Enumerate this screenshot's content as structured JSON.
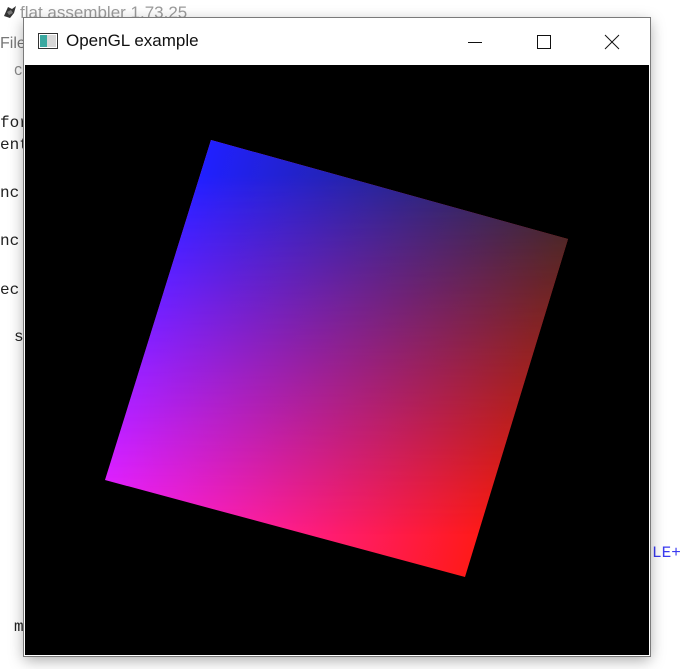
{
  "background_window": {
    "title": "flat assembler 1.73.25",
    "menu_file": "File",
    "tab_char": "C",
    "code_fragments": [
      {
        "text": "for",
        "color": "#222222"
      },
      {
        "text": "ent",
        "color": "#222222"
      },
      {
        "text": "nc",
        "color": "#222222"
      },
      {
        "text": "nc",
        "color": "#222222"
      },
      {
        "text": "ec",
        "color": "#222222"
      },
      {
        "text": "s",
        "color": "#222222"
      },
      {
        "text": "m",
        "color": "#222222"
      },
      {
        "text": "LE+",
        "color": "#3a3af0"
      }
    ]
  },
  "gl_window": {
    "title": "OpenGL example",
    "controls": {
      "minimize": "minimize-icon",
      "maximize": "maximize-icon",
      "close": "close-icon"
    },
    "canvas_background": "#000000",
    "quad_corner_colors": {
      "top_left": "#2020ff",
      "top_right": "#2a2a2a",
      "bottom_right": "#ff1a1a",
      "bottom_left": "#ff20ff"
    }
  }
}
